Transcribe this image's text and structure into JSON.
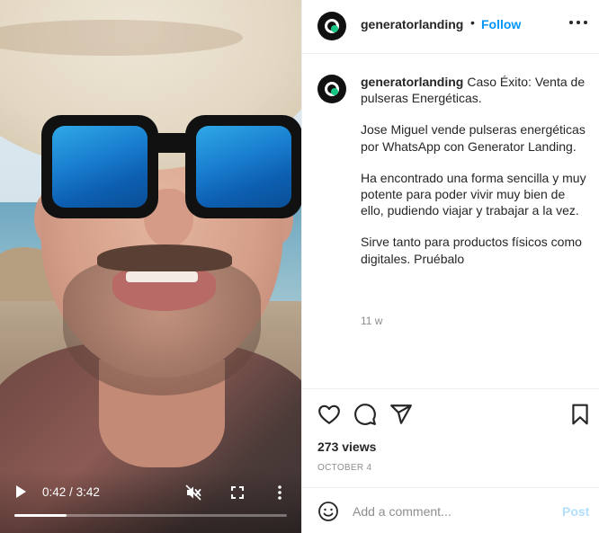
{
  "video": {
    "current_time": "0:42",
    "duration": "3:42",
    "time_separator": "/",
    "progress_fraction": 0.19
  },
  "header": {
    "username": "generatorlanding",
    "separator": "•",
    "follow_label": "Follow"
  },
  "caption": {
    "username": "generatorlanding",
    "paragraphs": [
      "Caso Éxito: Venta de pulseras Energéticas.",
      "Jose Miguel vende pulseras energéticas por WhatsApp con Generator Landing.",
      "Ha encontrado una forma sencilla y muy potente para poder vivir muy bien de ello, pudiendo viajar y trabajar a la vez.",
      "Sirve tanto para productos físicos como digitales. Pruébalo"
    ],
    "age": "11 w"
  },
  "stats": {
    "views": "273 views",
    "date": "OCTOBER 4"
  },
  "comment": {
    "placeholder": "Add a comment...",
    "post_label": "Post"
  },
  "colors": {
    "accent": "#0095f6",
    "post_disabled": "#b2dffc",
    "muted": "#8e8e8e",
    "avatar_dot": "#16c784"
  }
}
